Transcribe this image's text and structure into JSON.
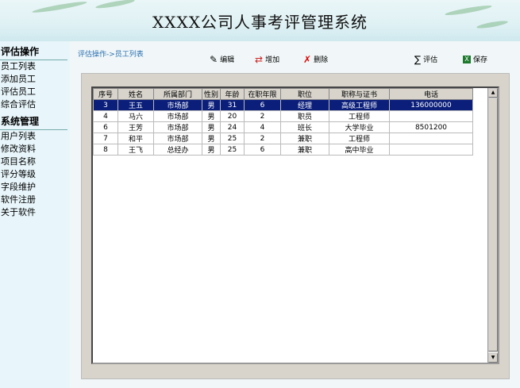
{
  "app": {
    "title": "XXXX公司人事考评管理系统"
  },
  "sidebar": {
    "sections": [
      {
        "title": "评估操作",
        "items": [
          "员工列表",
          "添加员工",
          "评估员工",
          "综合评估"
        ]
      },
      {
        "title": "系统管理",
        "items": [
          "用户列表",
          "修改资料",
          "项目名称",
          "评分等级",
          "字段维护",
          "软件注册",
          "关于软件"
        ]
      }
    ]
  },
  "breadcrumb": "评估操作->员工列表",
  "toolbar": {
    "edit": "编辑",
    "add": "增加",
    "delete": "删除",
    "evaluate": "评估",
    "save": "保存",
    "edit_icon": "edit-icon",
    "add_icon": "add-icon",
    "delete_icon": "delete-icon",
    "evaluate_icon": "sigma-icon",
    "save_icon": "excel-icon"
  },
  "table": {
    "columns": [
      "序号",
      "姓名",
      "所属部门",
      "性别",
      "年龄",
      "在职年限",
      "职位",
      "职称与证书",
      "电话"
    ],
    "rows": [
      [
        "3",
        "王五",
        "市场部",
        "男",
        "31",
        "6",
        "经理",
        "高级工程师",
        "136000000"
      ],
      [
        "4",
        "马六",
        "市场部",
        "男",
        "20",
        "2",
        "职员",
        "工程师",
        ""
      ],
      [
        "6",
        "王芳",
        "市场部",
        "男",
        "24",
        "4",
        "班长",
        "大学毕业",
        "8501200"
      ],
      [
        "7",
        "和平",
        "市场部",
        "男",
        "25",
        "2",
        "兼职",
        "工程师",
        ""
      ],
      [
        "8",
        "王飞",
        "总经办",
        "男",
        "25",
        "6",
        "兼职",
        "高中毕业",
        ""
      ]
    ],
    "selected_row": 0
  },
  "colors": {
    "selection": "#0a1e7a",
    "link": "#2a6fb0"
  }
}
